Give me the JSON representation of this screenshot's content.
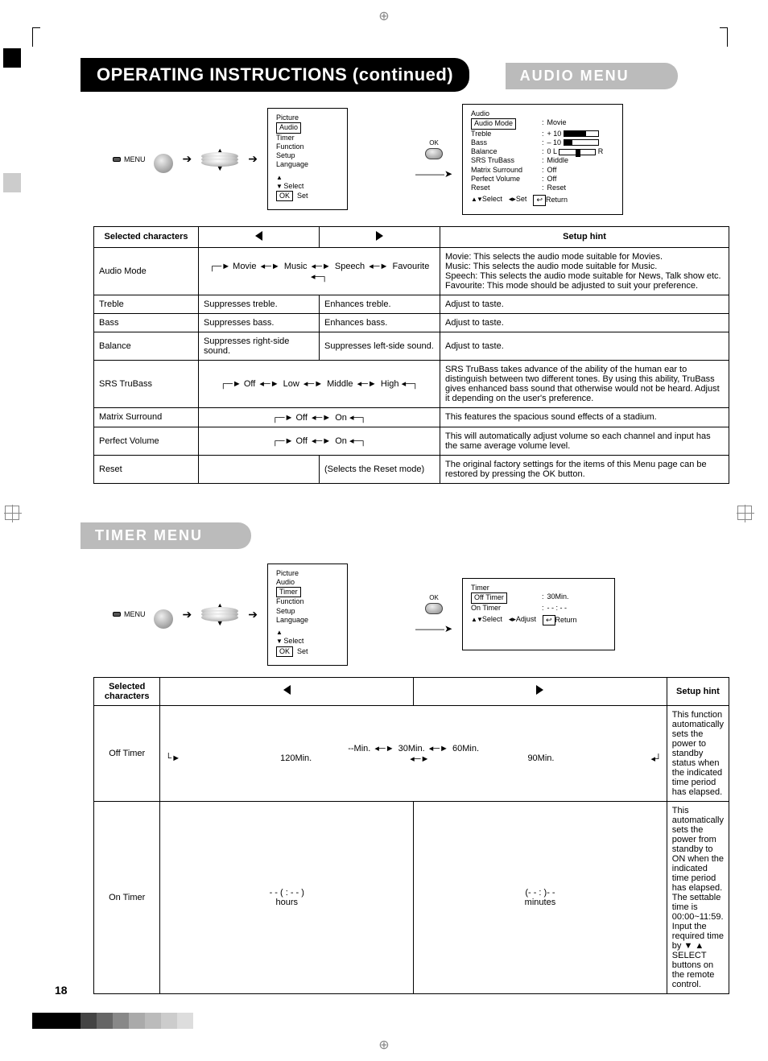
{
  "page_number": "18",
  "main_title": "OPERATING INSTRUCTIONS (continued)",
  "audio_section": {
    "title": "AUDIO MENU",
    "menu_button_label": "MENU",
    "ok_label": "OK",
    "osd1": {
      "items": [
        "Picture",
        "Audio",
        "Timer",
        "Function",
        "Setup",
        "Language"
      ],
      "selected_idx": 1,
      "footer_select": "Select",
      "footer_set": "OK   Set"
    },
    "osd2": {
      "title": "Audio",
      "rows": [
        {
          "k": "Audio Mode",
          "v": "Movie",
          "boxed": true,
          "bar": null
        },
        {
          "k": "Treble",
          "v": "+ 10",
          "bar": 0.65
        },
        {
          "k": "Bass",
          "v": "– 10",
          "bar": 0.25
        },
        {
          "k": "Balance",
          "v": "0 L",
          "balancebar": true,
          "tail": "R"
        },
        {
          "k": "SRS TruBass",
          "v": "Middle"
        },
        {
          "k": "Matrix Surround",
          "v": "Off"
        },
        {
          "k": "Perfect Volume",
          "v": "Off"
        },
        {
          "k": "Reset",
          "v": "Reset"
        }
      ],
      "footer": {
        "select": "Select",
        "set": "Set",
        "return": "Return"
      }
    },
    "table": {
      "head": {
        "col1": "Selected characters",
        "col4": "Setup hint"
      },
      "rows": [
        {
          "name": "Audio Mode",
          "cycle": [
            "Movie",
            "Music",
            "Speech",
            "Favourite"
          ],
          "span": 2,
          "hint": "Movie: This selects the audio mode suitable for Movies.\nMusic: This selects the audio mode suitable for Music.\nSpeech: This selects the audio mode suitable for News, Talk show etc.\nFavourite: This mode should be adjusted to suit your preference."
        },
        {
          "name": "Treble",
          "left": "Suppresses treble.",
          "right": "Enhances treble.",
          "hint": "Adjust to taste."
        },
        {
          "name": "Bass",
          "left": "Suppresses bass.",
          "right": "Enhances bass.",
          "hint": "Adjust to taste."
        },
        {
          "name": "Balance",
          "left": "Suppresses right-side sound.",
          "right": "Suppresses left-side sound.",
          "hint": "Adjust to taste."
        },
        {
          "name": "SRS TruBass",
          "cycle": [
            "Off",
            "Low",
            "Middle",
            "High"
          ],
          "span": 2,
          "hint": "SRS TruBass takes advance of the ability of the human ear to distinguish between two different tones. By using this ability, TruBass gives enhanced bass sound that otherwise would not be heard. Adjust it depending on the user's preference."
        },
        {
          "name": "Matrix Surround",
          "cycle": [
            "Off",
            "On"
          ],
          "span": 2,
          "hint": "This features the spacious sound effects of a stadium."
        },
        {
          "name": "Perfect Volume",
          "cycle": [
            "Off",
            "On"
          ],
          "span": 2,
          "hint": "This will automatically adjust volume so each channel and input has the same average volume level."
        },
        {
          "name": "Reset",
          "left": "",
          "right": "(Selects the Reset mode)",
          "hint": "The original factory settings for the items of this Menu page can be restored by pressing the OK button."
        }
      ]
    }
  },
  "timer_section": {
    "title": "TIMER MENU",
    "menu_button_label": "MENU",
    "ok_label": "OK",
    "osd1": {
      "items": [
        "Picture",
        "Audio",
        "Timer",
        "Function",
        "Setup",
        "Language"
      ],
      "selected_idx": 2,
      "footer_select": "Select",
      "footer_set": "OK  Set"
    },
    "osd2": {
      "title": "Timer",
      "rows": [
        {
          "k": "Off Timer",
          "v": "30Min.",
          "boxed": true
        },
        {
          "k": "On Timer",
          "v": "- -  :  - -"
        }
      ],
      "footer": {
        "select": "Select",
        "adjust": "Adjust",
        "return": "Return"
      }
    },
    "table": {
      "head": {
        "col1": "Selected characters",
        "col4": "Setup hint"
      },
      "rows": [
        {
          "name": "Off Timer",
          "cycle_multi": {
            "top": [
              "--Min.",
              "30Min.",
              "60Min."
            ],
            "bottom": [
              "120Min.",
              "90Min."
            ]
          },
          "span": 2,
          "center_name": true,
          "hint": "This function automatically sets the power to standby status when the indicated time period has elapsed."
        },
        {
          "name": "On Timer",
          "left": "- - ( : - - )\nhours",
          "right": "(- -  : )- -\nminutes",
          "center_name": true,
          "center_cells": true,
          "hint": "This automatically sets the power from standby to ON when the indicated time period has elapsed. The settable time is 00:00~11:59. Input the required time by ▼ ▲ SELECT buttons on the remote control."
        }
      ]
    }
  }
}
